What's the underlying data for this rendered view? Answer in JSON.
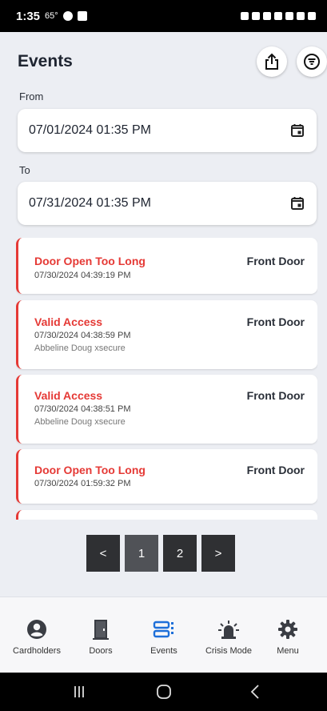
{
  "status_bar": {
    "time": "1:35",
    "temp": "65°"
  },
  "header": {
    "title": "Events"
  },
  "filters": {
    "from_label": "From",
    "from_value": "07/01/2024 01:35 PM",
    "to_label": "To",
    "to_value": "07/31/2024 01:35 PM"
  },
  "events": [
    {
      "type": "Door Open Too Long",
      "time": "07/30/2024 04:39:19 PM",
      "user": "",
      "door": "Front Door"
    },
    {
      "type": "Valid Access",
      "time": "07/30/2024 04:38:59 PM",
      "user": "Abbeline Doug xsecure",
      "door": "Front Door"
    },
    {
      "type": "Valid Access",
      "time": "07/30/2024 04:38:51 PM",
      "user": "Abbeline Doug xsecure",
      "door": "Front Door"
    },
    {
      "type": "Door Open Too Long",
      "time": "07/30/2024 01:59:32 PM",
      "user": "",
      "door": "Front Door"
    }
  ],
  "pagination": {
    "prev": "<",
    "pages": [
      "1",
      "2"
    ],
    "current": "1",
    "next": ">"
  },
  "bottom_nav": [
    {
      "label": "Cardholders",
      "icon": "account-circle-icon"
    },
    {
      "label": "Doors",
      "icon": "door-icon"
    },
    {
      "label": "Events",
      "icon": "events-icon",
      "active": true
    },
    {
      "label": "Crisis Mode",
      "icon": "alarm-light-icon"
    },
    {
      "label": "Menu",
      "icon": "gear-icon"
    }
  ],
  "colors": {
    "accent": "#1e6fd9",
    "alert": "#e53935",
    "page_bg": "#eceef3"
  }
}
